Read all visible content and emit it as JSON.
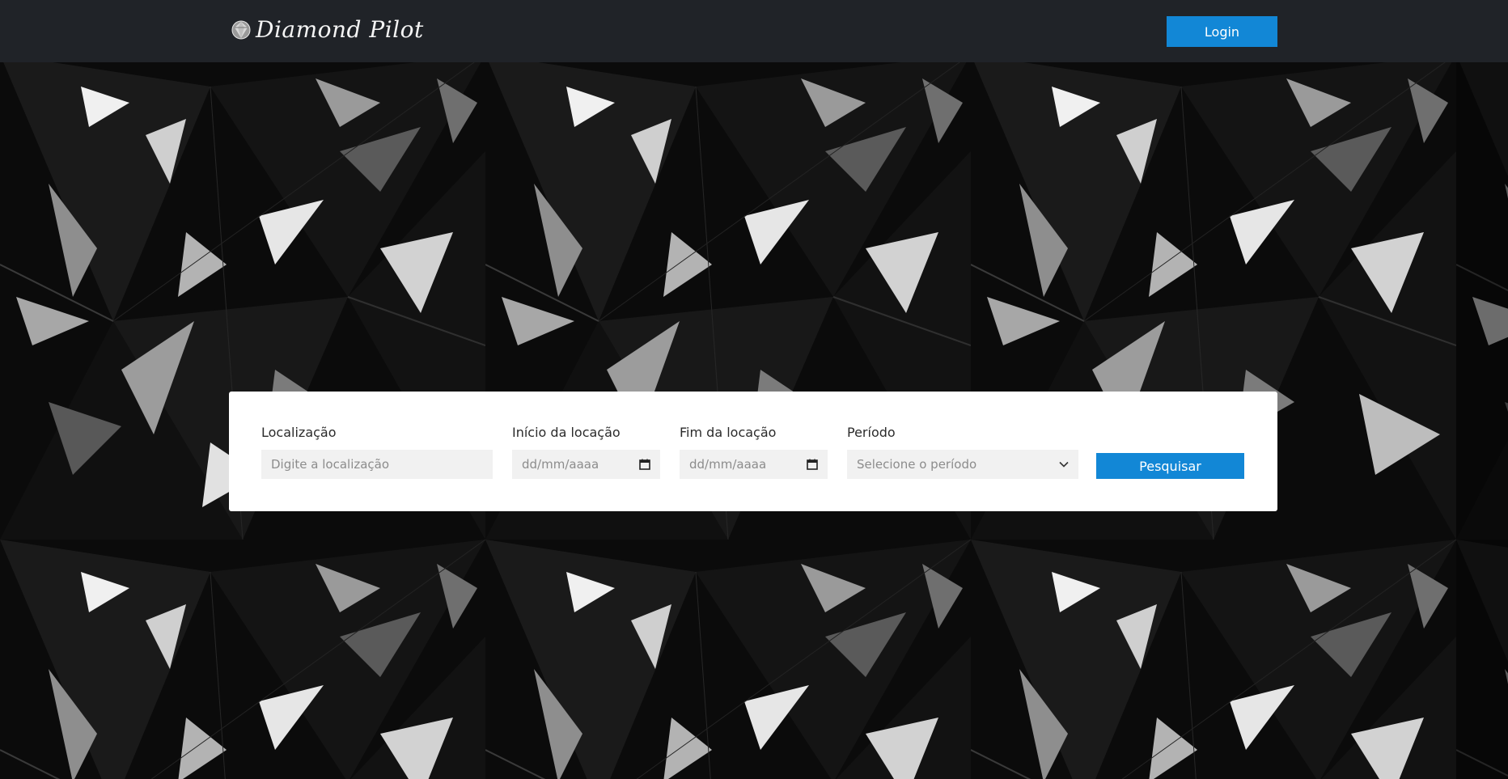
{
  "header": {
    "brand_name": "Diamond Pilot",
    "brand_icon": "diamond-logo-icon",
    "login_label": "Login"
  },
  "search": {
    "location": {
      "label": "Localização",
      "placeholder": "Digite a localização"
    },
    "start_date": {
      "label": "Início da locação",
      "placeholder": "dd/mm/aaaa",
      "icon": "calendar-icon"
    },
    "end_date": {
      "label": "Fim da locação",
      "placeholder": "dd/mm/aaaa",
      "icon": "calendar-icon"
    },
    "period": {
      "label": "Período",
      "selected": "Selecione o período",
      "icon": "chevron-down-icon"
    },
    "submit_label": "Pesquisar"
  },
  "colors": {
    "topbar": "#202328",
    "accent": "#1287d6",
    "card": "#ffffff",
    "field_bg": "#f1f1f1"
  }
}
